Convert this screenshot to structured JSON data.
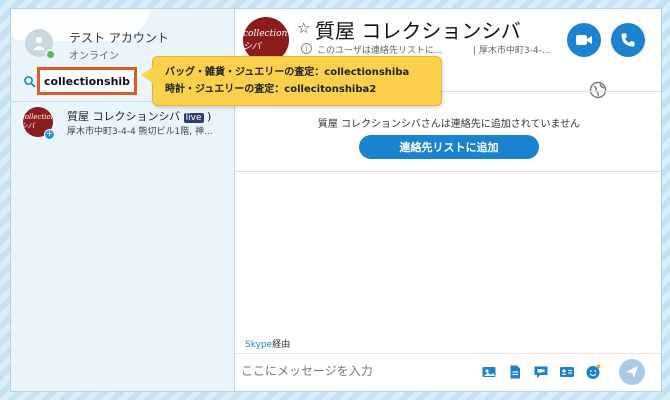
{
  "sidebar": {
    "me": {
      "name": "テスト アカウント",
      "status": "オンライン"
    },
    "search": {
      "value": "collectionshiba"
    },
    "results": [
      {
        "avatar_text": "collection シバ",
        "name": "質屋 コレクションシバ",
        "badge": "live",
        "address": "厚木市中町3-4-4 熊切ビル1階, 神..."
      }
    ]
  },
  "tooltip": {
    "line1": "バッグ・雑貨・ジュエリーの査定：collectionshiba",
    "line2": "時計・ジュエリーの査定：collecitonshiba2"
  },
  "chat": {
    "avatar_text": "collection シバ",
    "title": "質屋 コレクションシバ",
    "subtitle": "このユーザは連絡先リストに...",
    "location": "| 厚木市中町3-4-...",
    "not_in_contacts": "質屋 コレクションシバさんは連絡先に追加されていません",
    "add_contact_label": "連絡先リストに追加",
    "via_brand": "Skype",
    "via_suffix": "経由",
    "message_placeholder": "ここにメッセージを入力"
  },
  "colors": {
    "accent": "#1b82cf",
    "highlight": "#e05a2a",
    "tooltip": "#fbd04c",
    "online": "#5cb85c"
  }
}
